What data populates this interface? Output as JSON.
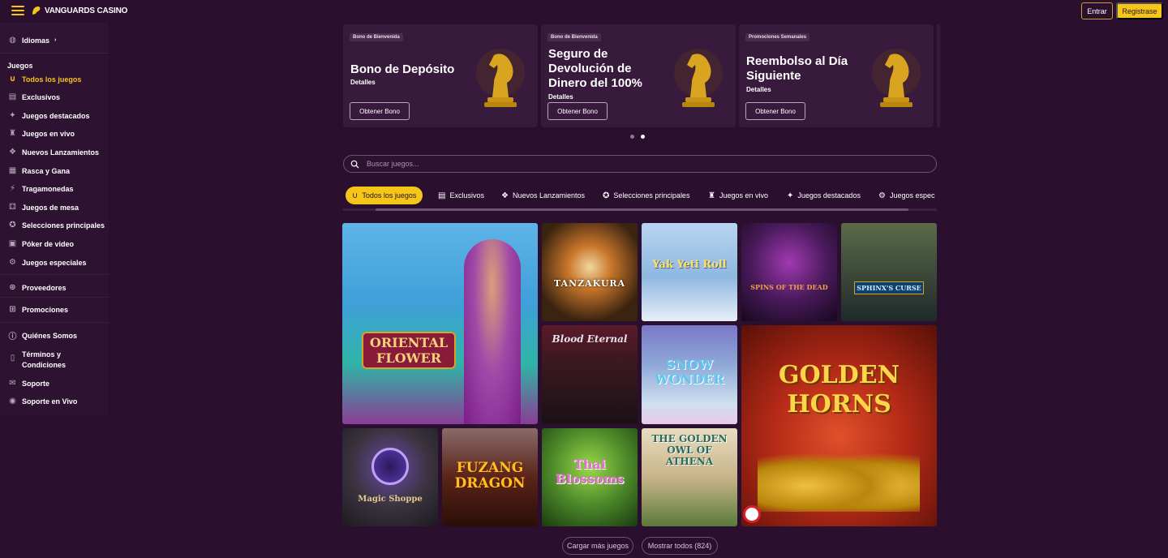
{
  "header": {
    "logo_text": "VANGUARDS CASINO",
    "login_label": "Entrar",
    "register_label": "Registrase"
  },
  "sidebar": {
    "language": "Idiomas",
    "section_title": "Juegos",
    "items": [
      {
        "label": "Todos los juegos",
        "icon": "horseshoe-icon",
        "active": true
      },
      {
        "label": "Exclusivos",
        "icon": "book-icon"
      },
      {
        "label": "Juegos destacados",
        "icon": "star-icon"
      },
      {
        "label": "Juegos en vivo",
        "icon": "dealer-icon"
      },
      {
        "label": "Nuevos Lanzamientos",
        "icon": "new-icon"
      },
      {
        "label": "Rasca y Gana",
        "icon": "scratch-icon"
      },
      {
        "label": "Tragamonedas",
        "icon": "slot-icon"
      },
      {
        "label": "Juegos de mesa",
        "icon": "dice-icon"
      },
      {
        "label": "Selecciones principales",
        "icon": "award-icon"
      },
      {
        "label": "Póker de video",
        "icon": "video-icon"
      },
      {
        "label": "Juegos especiales",
        "icon": "gear-icon"
      }
    ],
    "links": [
      {
        "label": "Proveedores",
        "icon": "chip-icon"
      },
      {
        "label": "Promociones",
        "icon": "gift-icon"
      },
      {
        "label": "Quiénes Somos",
        "icon": "info-icon"
      },
      {
        "label": "Términos y Condiciones",
        "icon": "document-icon"
      },
      {
        "label": "Soporte",
        "icon": "mail-icon"
      },
      {
        "label": "Soporte en Vivo",
        "icon": "chat-icon"
      }
    ]
  },
  "promos": [
    {
      "tag": "Bono de Bienvenida",
      "title": "Bono de Depósito",
      "details": "Detalles",
      "button": "Obtener Bono"
    },
    {
      "tag": "Bono de Bienvenida",
      "title": "Seguro de Devolución de Dinero del 100%",
      "details": "Detalles",
      "button": "Obtener Bono"
    },
    {
      "tag": "Promociones Semanales",
      "title": "Reembolso al Día Siguiente",
      "details": "Detalles",
      "button": "Obtener Bono"
    }
  ],
  "search": {
    "placeholder": "Buscar juegos..."
  },
  "tabs": [
    {
      "label": "Todos los juegos",
      "icon": "horseshoe-icon",
      "active": true
    },
    {
      "label": "Exclusivos",
      "icon": "book-icon"
    },
    {
      "label": "Nuevos Lanzamientos",
      "icon": "new-icon"
    },
    {
      "label": "Selecciones principales",
      "icon": "award-icon"
    },
    {
      "label": "Juegos en vivo",
      "icon": "dealer-icon"
    },
    {
      "label": "Juegos destacados",
      "icon": "star-icon"
    },
    {
      "label": "Juegos espec",
      "icon": "gear-icon"
    }
  ],
  "games": [
    {
      "name": "ORIENTAL FLOWER",
      "color": "#3f9fd8"
    },
    {
      "name": "TANZAKURA",
      "color": "#6b4a1d"
    },
    {
      "name": "Yak Yeti Roll",
      "color": "#8fb8e0"
    },
    {
      "name": "SPINS OF THE DEAD",
      "color": "#4a1a5c"
    },
    {
      "name": "SPHINX'S CURSE",
      "color": "#3e4a38"
    },
    {
      "name": "Blood Eternal",
      "color": "#3a1820"
    },
    {
      "name": "SNOW WONDER",
      "color": "#8fa8d8"
    },
    {
      "name": "GOLDEN HORNS",
      "color": "#b52a17"
    },
    {
      "name": "Magic Shoppe",
      "color": "#3c3440"
    },
    {
      "name": "FUZANG DRAGON",
      "color": "#5a2418"
    },
    {
      "name": "Thai Blossoms",
      "color": "#4d8a2a"
    },
    {
      "name": "THE GOLDEN OWL OF ATHENA",
      "color": "#c9b48a"
    }
  ],
  "load_more": "Cargar más juegos",
  "show_all": "Mostrar todos (824)",
  "colors": {
    "accent": "#f5c518",
    "background": "#2a0f2e",
    "panel": "#381a3c"
  }
}
